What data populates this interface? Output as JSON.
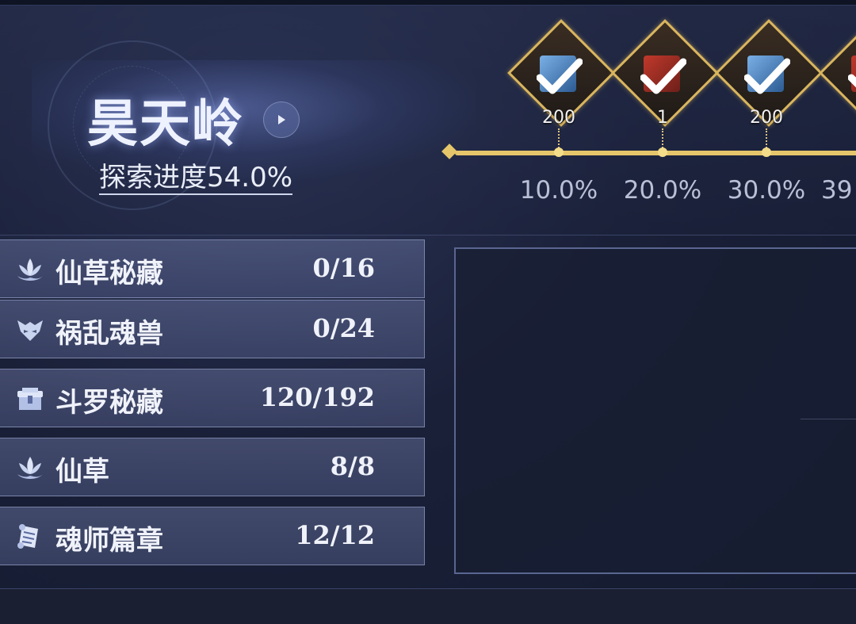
{
  "region": {
    "title": "昊天岭",
    "progress_text": "探索进度54.0%"
  },
  "milestones": [
    {
      "reward_icon": "blue-book-icon",
      "count": "200",
      "percent": "10.0%",
      "claimed": true
    },
    {
      "reward_icon": "red-scroll-icon",
      "count": "1",
      "percent": "20.0%",
      "claimed": true
    },
    {
      "reward_icon": "blue-book-icon",
      "count": "200",
      "percent": "30.0%",
      "claimed": true
    },
    {
      "reward_icon": "red-scroll-icon",
      "count": "",
      "percent": "39",
      "claimed": true
    }
  ],
  "categories": [
    {
      "icon": "lotus-icon",
      "label": "仙草秘藏",
      "count": "0/16"
    },
    {
      "icon": "beast-mask-icon",
      "label": "祸乱魂兽",
      "count": "0/24"
    },
    {
      "icon": "treasure-chest-icon",
      "label": "斗罗秘藏",
      "count": "120/192"
    },
    {
      "icon": "lotus-icon",
      "label": "仙草",
      "count": "8/8"
    },
    {
      "icon": "scroll-icon",
      "label": "魂师篇章",
      "count": "12/12"
    }
  ],
  "colors": {
    "accent_gold": "#e6c66a",
    "panel_border": "#5a6690"
  }
}
